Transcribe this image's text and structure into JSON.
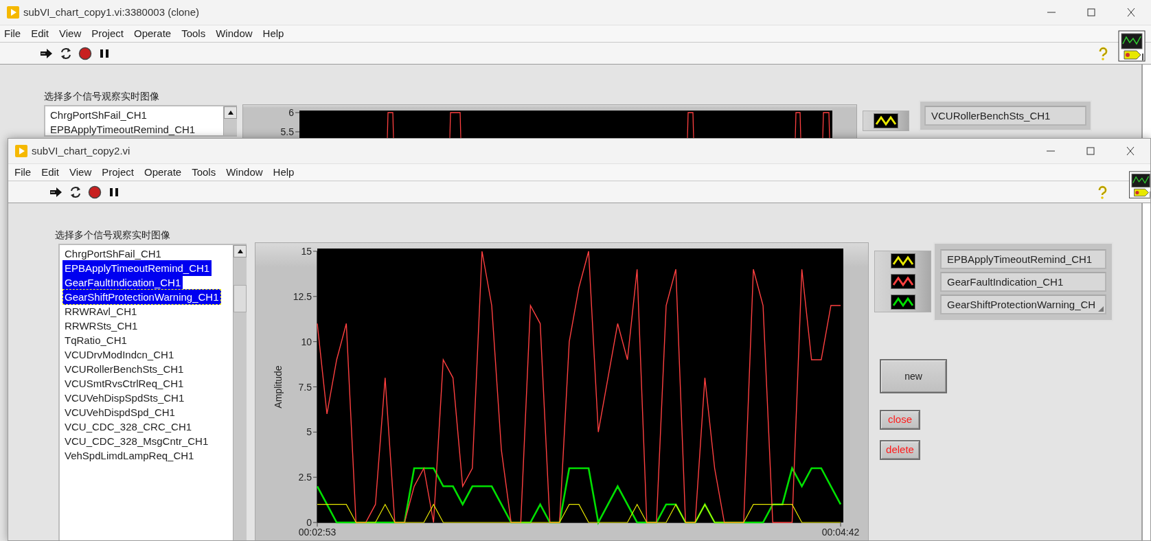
{
  "windows": [
    {
      "title": "subVI_chart_copy1.vi:3380003 (clone)",
      "menu": [
        "File",
        "Edit",
        "View",
        "Project",
        "Operate",
        "Tools",
        "Window",
        "Help"
      ],
      "list_label": "选择多个信号观察实时图像",
      "list_items": [
        {
          "label": "ChrgPortShFail_CH1",
          "selected": false
        },
        {
          "label": "EPBApplyTimeoutRemind_CH1",
          "selected": false
        }
      ],
      "chart": {
        "yticks": [
          "6",
          "5.5"
        ]
      },
      "legend": [
        {
          "label": "VCURollerBenchSts_CH1",
          "color": "#e8e800"
        }
      ]
    },
    {
      "title": "subVI_chart_copy2.vi",
      "menu": [
        "File",
        "Edit",
        "View",
        "Project",
        "Operate",
        "Tools",
        "Window",
        "Help"
      ],
      "list_label": "选择多个信号观察实时图像",
      "list_items": [
        {
          "label": "ChrgPortShFail_CH1",
          "selected": false,
          "focused": false
        },
        {
          "label": "EPBApplyTimeoutRemind_CH1",
          "selected": true,
          "focused": false
        },
        {
          "label": "GearFaultIndication_CH1",
          "selected": true,
          "focused": false
        },
        {
          "label": "GearShiftProtectionWarning_CH1",
          "selected": true,
          "focused": true
        },
        {
          "label": "RRWRAvl_CH1",
          "selected": false,
          "focused": false
        },
        {
          "label": "RRWRSts_CH1",
          "selected": false,
          "focused": false
        },
        {
          "label": "TqRatio_CH1",
          "selected": false,
          "focused": false
        },
        {
          "label": "VCUDrvModIndcn_CH1",
          "selected": false,
          "focused": false
        },
        {
          "label": "VCURollerBenchSts_CH1",
          "selected": false,
          "focused": false
        },
        {
          "label": "VCUSmtRvsCtrlReq_CH1",
          "selected": false,
          "focused": false
        },
        {
          "label": "VCUVehDispSpdSts_CH1",
          "selected": false,
          "focused": false
        },
        {
          "label": "VCUVehDispdSpd_CH1",
          "selected": false,
          "focused": false
        },
        {
          "label": "VCU_CDC_328_CRC_CH1",
          "selected": false,
          "focused": false
        },
        {
          "label": "VCU_CDC_328_MsgCntr_CH1",
          "selected": false,
          "focused": false
        },
        {
          "label": "VehSpdLimdLampReq_CH1",
          "selected": false,
          "focused": false
        }
      ],
      "chart": {
        "chart_data": {
          "type": "line",
          "ylabel": "Amplitude",
          "categories": [
            "00:02:53",
            null,
            null,
            null,
            null,
            null,
            null,
            null,
            null,
            null,
            null,
            null,
            null,
            null,
            null,
            null,
            null,
            null,
            null,
            null,
            null,
            null,
            null,
            null,
            null,
            null,
            null,
            null,
            null,
            null,
            null,
            null,
            null,
            null,
            null,
            null,
            null,
            null,
            null,
            null,
            null,
            null,
            null,
            null,
            null,
            null,
            null,
            null,
            null,
            null,
            null,
            null,
            null,
            null,
            "00:04:42"
          ],
          "ylim": [
            0,
            15
          ],
          "yticks": [
            0,
            2.5,
            5,
            7.5,
            10,
            12.5,
            15
          ],
          "series": [
            {
              "name": "EPBApplyTimeoutRemind_CH1",
              "color": "#e8e800",
              "values": [
                1,
                1,
                1,
                1,
                0,
                0,
                0,
                1,
                0,
                0,
                0,
                0,
                1,
                0,
                0,
                0,
                0,
                0,
                0,
                0,
                0,
                0,
                0,
                0,
                0,
                0,
                1,
                1,
                0,
                0,
                0,
                0,
                0,
                1,
                0,
                0,
                0,
                1,
                0,
                0,
                1,
                0,
                0,
                0,
                0,
                1,
                1,
                1,
                1,
                1,
                0,
                0,
                0,
                0,
                0
              ]
            },
            {
              "name": "GearFaultIndication_CH1",
              "color": "#ff4040",
              "values": [
                11,
                6,
                9,
                11,
                0,
                0,
                1,
                8,
                0,
                0,
                2,
                3,
                0,
                9,
                8,
                2,
                3,
                15,
                12,
                4,
                0,
                0,
                12,
                11,
                0,
                0,
                10,
                13,
                15,
                5,
                8,
                11,
                9,
                14,
                0,
                0,
                12,
                14,
                0,
                0,
                8,
                3,
                0,
                0,
                0,
                14,
                12,
                0,
                0,
                0,
                14,
                9,
                9,
                12,
                12
              ]
            },
            {
              "name": "GearShiftProtectionWarning_CH",
              "color": "#00e000",
              "values": [
                2,
                1,
                0,
                0,
                0,
                0,
                0,
                0,
                0,
                0,
                3,
                3,
                3,
                2,
                2,
                1,
                2,
                2,
                2,
                1,
                0,
                0,
                0,
                1,
                0,
                0,
                3,
                3,
                3,
                0,
                1,
                2,
                1,
                0,
                0,
                0,
                1,
                1,
                0,
                0,
                1,
                0,
                0,
                0,
                0,
                0,
                0,
                1,
                1,
                3,
                2,
                3,
                3,
                2,
                1
              ]
            }
          ]
        }
      },
      "buttons": [
        {
          "label": "new",
          "kind": "normal"
        },
        {
          "label": "close",
          "kind": "alert"
        },
        {
          "label": "delete",
          "kind": "alert"
        }
      ]
    }
  ]
}
